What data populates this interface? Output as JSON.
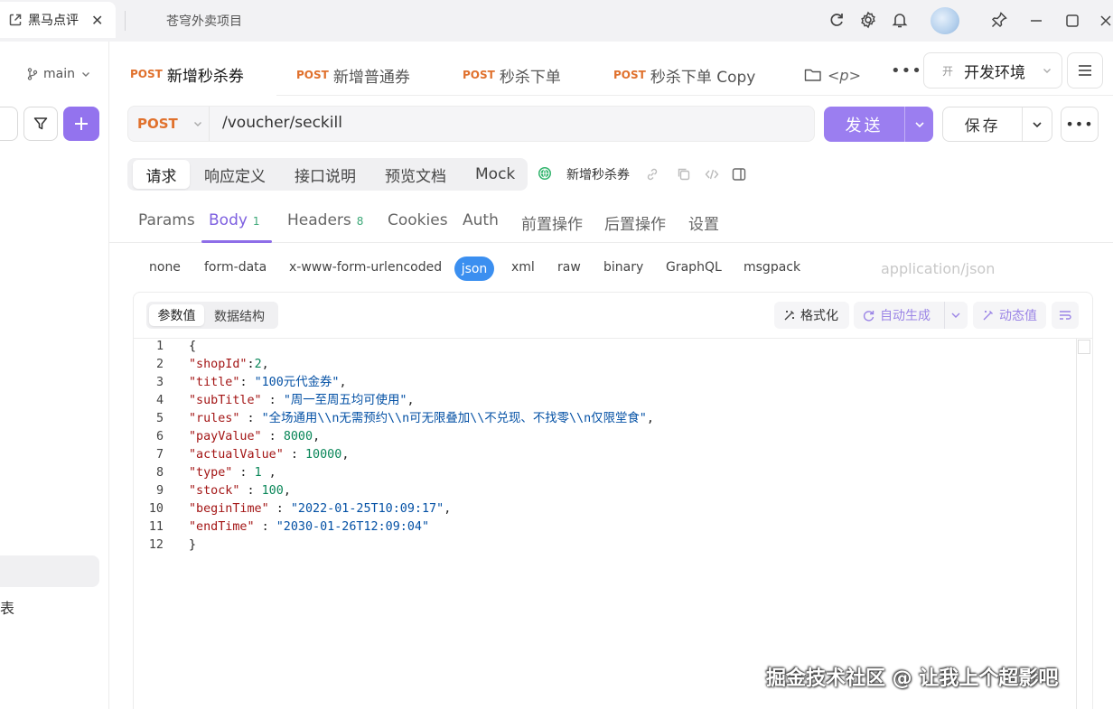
{
  "window": {
    "active_tab": "黑马点评",
    "inactive_tab": "苍穹外卖项目"
  },
  "sidebar": {
    "branch": "main",
    "cut_text": "表"
  },
  "request_tabs": [
    {
      "method": "POST",
      "label": "新增秒杀券"
    },
    {
      "method": "POST",
      "label": "新增普通券"
    },
    {
      "method": "POST",
      "label": "秒杀下单"
    },
    {
      "method": "POST",
      "label": "秒杀下单 Copy"
    },
    {
      "label": "<p>"
    }
  ],
  "environment": {
    "badge": "开",
    "label": "开发环境"
  },
  "url_bar": {
    "method": "POST",
    "url": "/voucher/seckill",
    "send": "发送",
    "save": "保存"
  },
  "mode_tabs": [
    "请求",
    "响应定义",
    "接口说明",
    "预览文档",
    "Mock"
  ],
  "api_name": "新增秒杀券",
  "sub_tabs": [
    {
      "label": "Params"
    },
    {
      "label": "Body",
      "count": "1"
    },
    {
      "label": "Headers",
      "count": "8"
    },
    {
      "label": "Cookies"
    },
    {
      "label": "Auth"
    },
    {
      "label": "前置操作"
    },
    {
      "label": "后置操作"
    },
    {
      "label": "设置"
    }
  ],
  "body_types": [
    "none",
    "form-data",
    "x-www-form-urlencoded",
    "json",
    "xml",
    "raw",
    "binary",
    "GraphQL",
    "msgpack"
  ],
  "content_type": "application/json",
  "editor": {
    "value_tabs": [
      "参数值",
      "数据结构"
    ],
    "format": "格式化",
    "auto_generate": "自动生成",
    "dynamic_value": "动态值",
    "lines": [
      {
        "n": "1",
        "text": "{"
      },
      {
        "n": "2",
        "key": "\"shopId\"",
        "sep": ":",
        "val": "2",
        "vt": "n",
        "tail": ","
      },
      {
        "n": "3",
        "key": "\"title\"",
        "sep": ": ",
        "val": "\"100元代金券\"",
        "vt": "s",
        "tail": ","
      },
      {
        "n": "4",
        "key": "\"subTitle\"",
        "sep": " : ",
        "val": "\"周一至周五均可使用\"",
        "vt": "s",
        "tail": ","
      },
      {
        "n": "5",
        "key": "\"rules\"",
        "sep": " : ",
        "val": "\"全场通用\\\\n无需预约\\\\n可无限叠加\\\\不兑现、不找零\\\\n仅限堂食\"",
        "vt": "s",
        "tail": ","
      },
      {
        "n": "6",
        "key": "\"payValue\"",
        "sep": " : ",
        "val": "8000",
        "vt": "n",
        "tail": ","
      },
      {
        "n": "7",
        "key": "\"actualValue\"",
        "sep": " : ",
        "val": "10000",
        "vt": "n",
        "tail": ","
      },
      {
        "n": "8",
        "key": "\"type\"",
        "sep": " : ",
        "val": "1",
        "vt": "n",
        "tail": " ,"
      },
      {
        "n": "9",
        "key": "\"stock\"",
        "sep": " : ",
        "val": "100",
        "vt": "n",
        "tail": ","
      },
      {
        "n": "10",
        "key": "\"beginTime\"",
        "sep": " : ",
        "val": "\"2022-01-25T10:09:17\"",
        "vt": "s",
        "tail": ","
      },
      {
        "n": "11",
        "key": "\"endTime\"",
        "sep": " : ",
        "val": "\"2030-01-26T12:09:04\"",
        "vt": "s",
        "tail": ""
      },
      {
        "n": "12",
        "text": "}"
      }
    ]
  },
  "watermark": "掘金技术社区 @ 让我上个超影吧",
  "colors": {
    "accent": "#9373ee",
    "send": "#9b7ef0",
    "method": "#e0712d",
    "json_pill": "#3b8ff0",
    "count": "#3aa776"
  }
}
